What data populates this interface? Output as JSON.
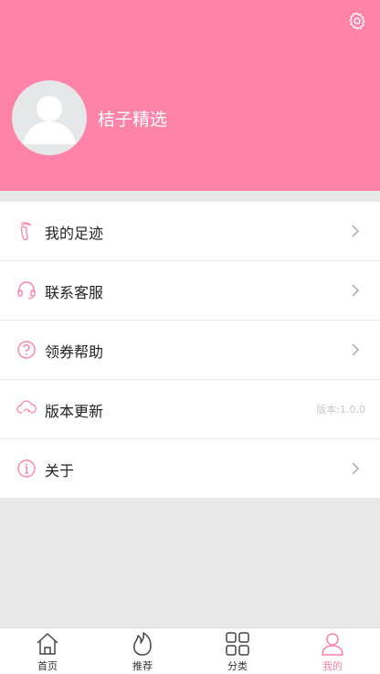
{
  "header": {
    "username": "桔子精选"
  },
  "menu": [
    {
      "label": "我的足迹",
      "icon": "footprint-icon"
    },
    {
      "label": "联系客服",
      "icon": "headset-icon"
    },
    {
      "label": "领券帮助",
      "icon": "question-icon"
    },
    {
      "label": "版本更新",
      "icon": "cloud-update-icon",
      "version": "版本:1.0.0"
    },
    {
      "label": "关于",
      "icon": "info-icon"
    }
  ],
  "tabbar": [
    {
      "label": "首页",
      "icon": "home-icon"
    },
    {
      "label": "推荐",
      "icon": "flame-icon"
    },
    {
      "label": "分类",
      "icon": "grid-icon"
    },
    {
      "label": "我的",
      "icon": "user-icon",
      "active": true
    }
  ],
  "colors": {
    "accent": "#ff82a8",
    "background": "#e8e8e8"
  }
}
